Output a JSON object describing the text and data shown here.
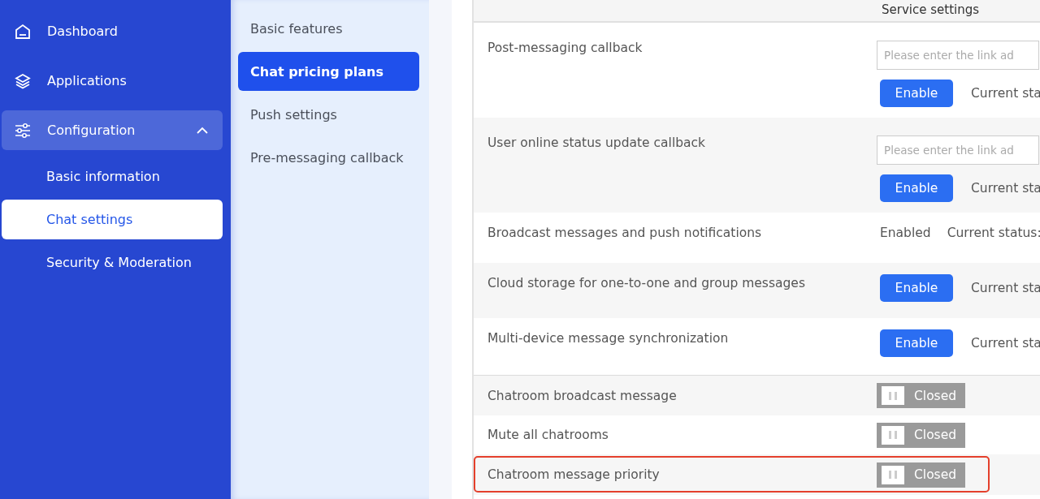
{
  "sidebar": {
    "items": [
      {
        "label": "Dashboard",
        "selected": false
      },
      {
        "label": "Applications",
        "selected": false
      },
      {
        "label": "Configuration",
        "selected": false,
        "expanded": true,
        "children": [
          {
            "label": "Basic information",
            "selected": false
          },
          {
            "label": "Chat settings",
            "selected": true
          },
          {
            "label": "Security & Moderation",
            "selected": false
          }
        ]
      }
    ]
  },
  "submenu": {
    "items": [
      {
        "label": "Basic features",
        "selected": false
      },
      {
        "label": "Chat pricing plans",
        "selected": true
      },
      {
        "label": "Push settings",
        "selected": false
      },
      {
        "label": "Pre-messaging callback",
        "selected": false
      }
    ]
  },
  "table": {
    "header": "Service settings",
    "rows": [
      {
        "kind": "callback",
        "label": "Post-messaging callback",
        "placeholder": "Please enter the link ad",
        "button": "Enable",
        "status": "Current sta",
        "highlighted": false
      },
      {
        "kind": "callback",
        "label": "User online status update callback",
        "placeholder": "Please enter the link ad",
        "button": "Enable",
        "status": "Current sta",
        "highlighted": false
      },
      {
        "kind": "text",
        "label": "Broadcast messages and push notifications",
        "value": "Enabled",
        "status": "Current status:",
        "highlighted": false
      },
      {
        "kind": "button",
        "label": "Cloud storage for one-to-one and group messages",
        "button": "Enable",
        "status": "Current sta",
        "highlighted": false
      },
      {
        "kind": "button",
        "label": "Multi-device message synchronization",
        "button": "Enable",
        "status": "Current sta",
        "highlighted": false
      },
      {
        "kind": "toggle",
        "label": "Chatroom broadcast message",
        "on": false,
        "state": "Closed",
        "highlighted": false
      },
      {
        "kind": "toggle",
        "label": "Mute all chatrooms",
        "on": false,
        "state": "Closed",
        "highlighted": false
      },
      {
        "kind": "toggle",
        "label": "Chatroom message priority",
        "on": false,
        "state": "Closed",
        "highlighted": true
      }
    ]
  }
}
